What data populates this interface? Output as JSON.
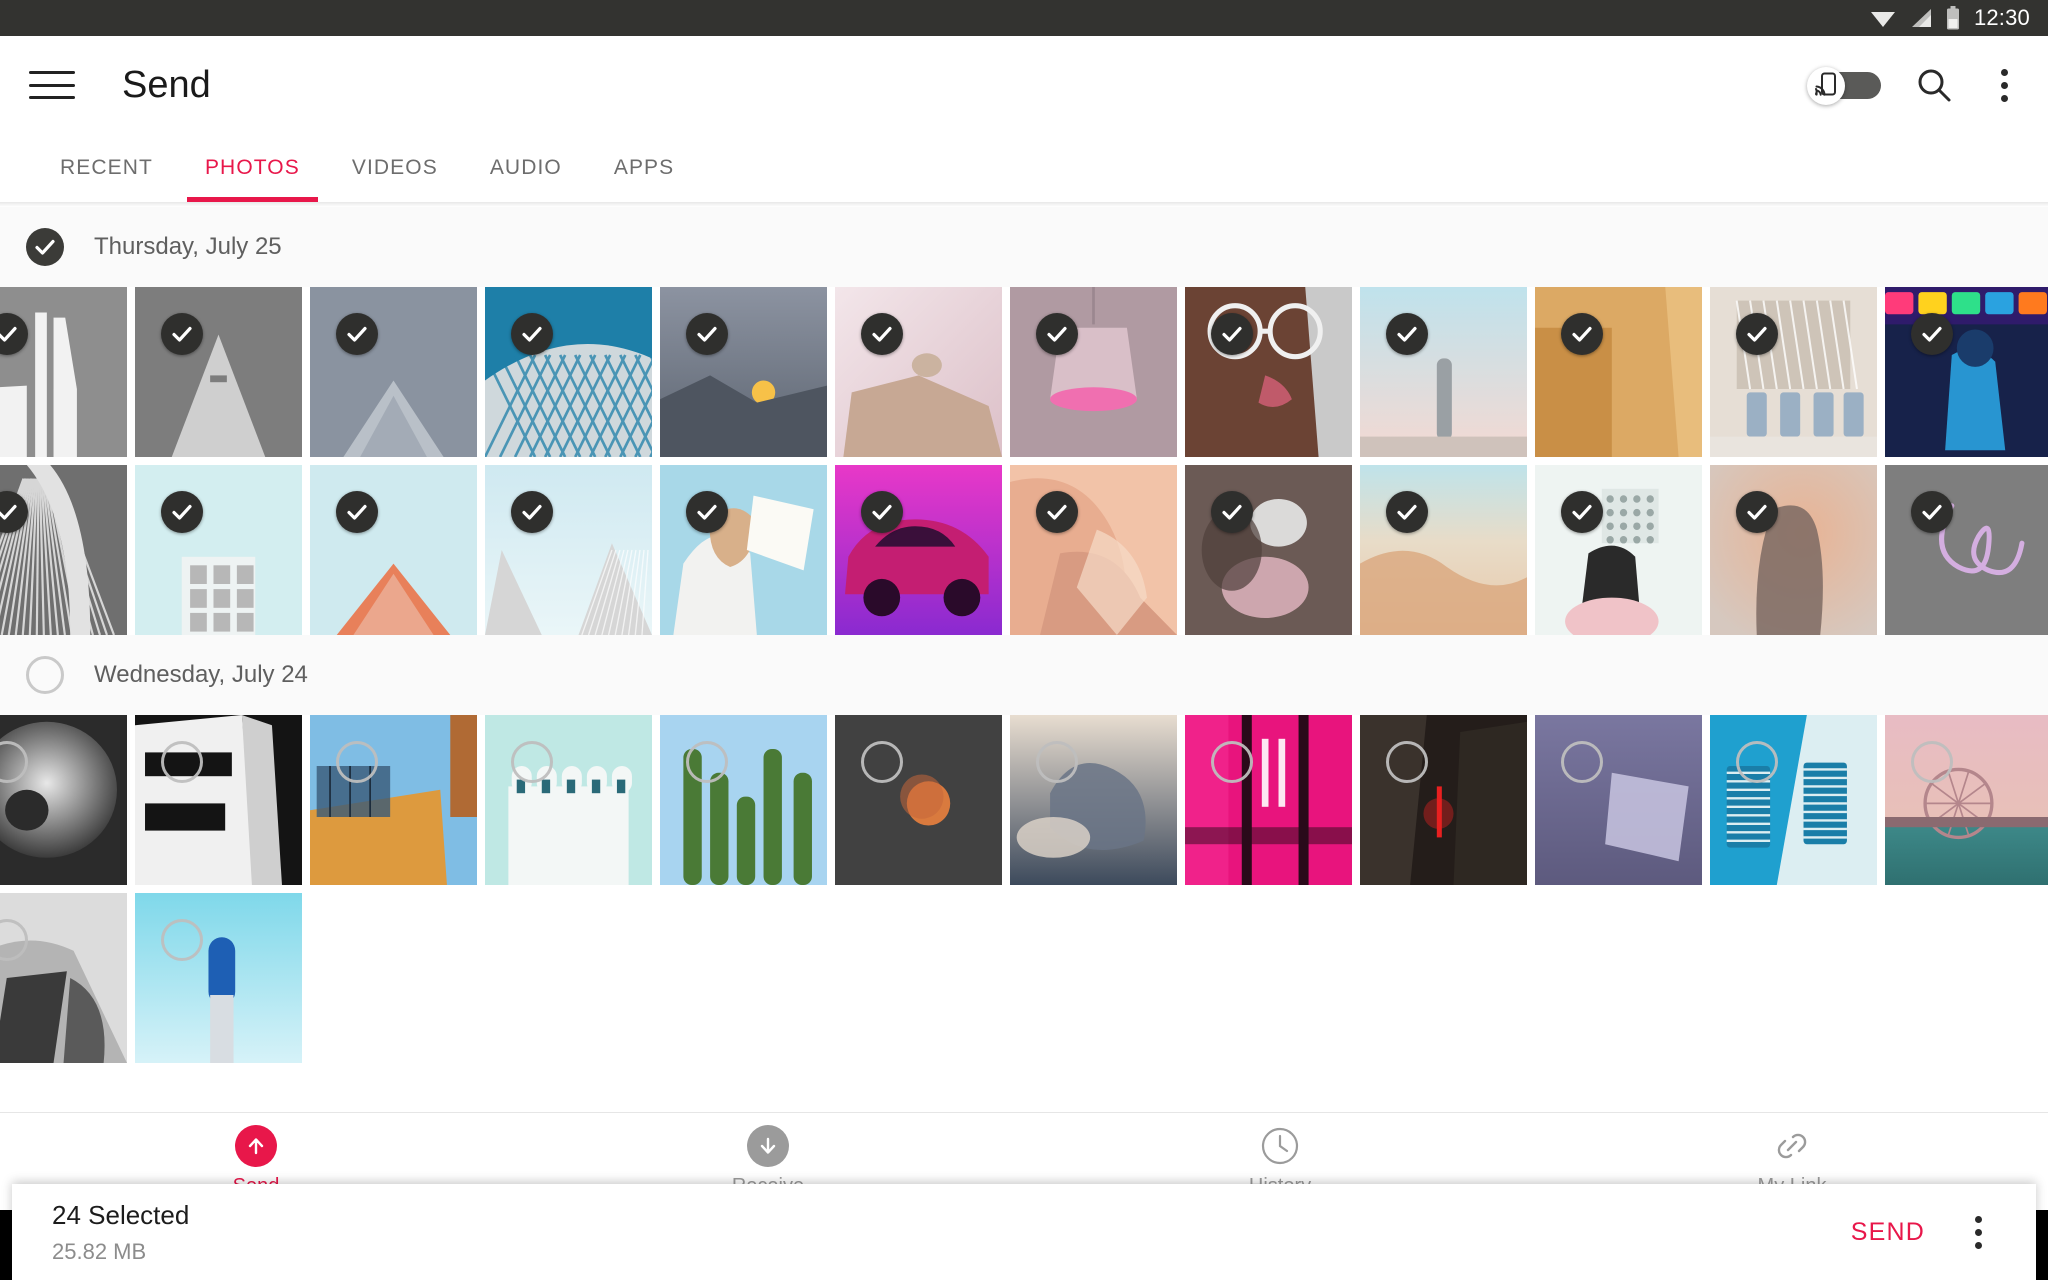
{
  "status_bar": {
    "time": "12:30",
    "icons": [
      "wifi-icon",
      "signal-icon",
      "battery-icon"
    ]
  },
  "toolbar": {
    "menu_icon": "hamburger-menu-icon",
    "title": "Send",
    "cast_toggle": {
      "icon": "cast-phone-icon",
      "state": "off"
    },
    "search_icon": "search-icon",
    "overflow_icon": "overflow-menu-icon"
  },
  "tabs": {
    "active": "PHOTOS",
    "items": [
      {
        "label": "RECENT"
      },
      {
        "label": "PHOTOS"
      },
      {
        "label": "VIDEOS"
      },
      {
        "label": "AUDIO"
      },
      {
        "label": "APPS"
      }
    ]
  },
  "sections": [
    {
      "date_label": "Thursday, July 25",
      "checked": true,
      "photos": [
        {
          "alt": "white-monument-architecture",
          "selected": true,
          "c1": "#8e8e8e",
          "c2": "#f2f2f2",
          "kind": "monument"
        },
        {
          "alt": "concrete-tower-upward",
          "selected": true,
          "c1": "#7d7d7d",
          "c2": "#cfcfcf",
          "kind": "tunnel"
        },
        {
          "alt": "gray-roof-peak",
          "selected": true,
          "c1": "#8a93a0",
          "c2": "#b9c0c8",
          "kind": "peak"
        },
        {
          "alt": "blue-lattice-facade",
          "selected": true,
          "c1": "#1e7fa8",
          "c2": "#cfd8dc",
          "kind": "lattice"
        },
        {
          "alt": "mountain-sunset-dusk",
          "selected": true,
          "c1": "#8c93a1",
          "c2": "#5c6470",
          "kind": "sunset"
        },
        {
          "alt": "leopard-on-rock",
          "selected": true,
          "c1": "#f3e6ea",
          "c2": "#c7a894",
          "kind": "rock"
        },
        {
          "alt": "pink-pendant-lamp",
          "selected": true,
          "c1": "#b09aa2",
          "c2": "#f06fb0",
          "kind": "lamp"
        },
        {
          "alt": "woman-with-glasses-portrait",
          "selected": true,
          "c1": "#6b4334",
          "c2": "#d6b3a0",
          "kind": "portrait"
        },
        {
          "alt": "person-standing-in-mist",
          "selected": true,
          "c1": "#bfe2ec",
          "c2": "#f4d9d2",
          "kind": "mist"
        },
        {
          "alt": "orange-wall-corner",
          "selected": true,
          "c1": "#dca964",
          "c2": "#c98f46",
          "kind": "wall"
        },
        {
          "alt": "hello-hustler-cafe-interior",
          "selected": true,
          "c1": "#e6ded5",
          "c2": "#b9aea1",
          "kind": "cafe"
        },
        {
          "alt": "neon-concert-performer",
          "selected": true,
          "c1": "#17224a",
          "c2": "#2aa2e0",
          "kind": "neon"
        },
        {
          "alt": "bridge-cables-grayscale",
          "selected": true,
          "c1": "#6f6f6f",
          "c2": "#e2e2e2",
          "kind": "cables"
        },
        {
          "alt": "window-grid-pale-blue",
          "selected": true,
          "c1": "#d3eef0",
          "c2": "#b7b7b7",
          "kind": "windows"
        },
        {
          "alt": "orange-roof-house",
          "selected": true,
          "c1": "#cfeaef",
          "c2": "#e8805a",
          "kind": "house"
        },
        {
          "alt": "two-white-gables",
          "selected": true,
          "c1": "#cfe9f1",
          "c2": "#d6d6d6",
          "kind": "gables"
        },
        {
          "alt": "woman-reading-book",
          "selected": true,
          "c1": "#a8d8e8",
          "c2": "#d8b08a",
          "kind": "reading"
        },
        {
          "alt": "magenta-classic-car",
          "selected": true,
          "c1": "#e838c8",
          "c2": "#8a2ad0",
          "kind": "car"
        },
        {
          "alt": "peach-canyon-rock",
          "selected": true,
          "c1": "#f2c3a8",
          "c2": "#d89b82",
          "kind": "canyon"
        },
        {
          "alt": "smoke-portrait-dark",
          "selected": true,
          "c1": "#6b5a55",
          "c2": "#e6b9c4",
          "kind": "smoke"
        },
        {
          "alt": "desert-dune-minimal",
          "selected": true,
          "c1": "#bfe3ea",
          "c2": "#e8c7a8",
          "kind": "dune"
        },
        {
          "alt": "woman-holding-paper",
          "selected": true,
          "c1": "#eef4f2",
          "c2": "#f0c3c8",
          "kind": "paper"
        },
        {
          "alt": "man-bowed-head-orange-glow",
          "selected": true,
          "c1": "#e8b394",
          "c2": "#7d6a63",
          "kind": "glow"
        },
        {
          "alt": "love-light-writing",
          "selected": true,
          "c1": "#7e7e7e",
          "c2": "#d4aee0",
          "kind": "love"
        }
      ]
    },
    {
      "date_label": "Wednesday, July 24",
      "checked": false,
      "photos": [
        {
          "alt": "spiral-sculpture-bw",
          "selected": false,
          "c1": "#2b2b2b",
          "c2": "#e8e8e8",
          "kind": "spiral"
        },
        {
          "alt": "modern-building-bw",
          "selected": false,
          "c1": "#141414",
          "c2": "#f0f0f0",
          "kind": "bwbuild"
        },
        {
          "alt": "orange-brick-building-sky",
          "selected": false,
          "c1": "#7fbde4",
          "c2": "#dd9a3e",
          "kind": "brick"
        },
        {
          "alt": "white-columns-mint",
          "selected": false,
          "c1": "#bfe8e4",
          "c2": "#f3f7f6",
          "kind": "columns"
        },
        {
          "alt": "cactus-against-sky",
          "selected": false,
          "c1": "#a8d4f0",
          "c2": "#4a7a36",
          "kind": "cactus"
        },
        {
          "alt": "blood-moon-dark-sky",
          "selected": false,
          "c1": "#414141",
          "c2": "#d97a3e",
          "kind": "moon"
        },
        {
          "alt": "dramatic-clouds-sunset",
          "selected": false,
          "c1": "#e8ddd0",
          "c2": "#3d4a5c",
          "kind": "clouds"
        },
        {
          "alt": "pink-neon-corridor",
          "selected": false,
          "c1": "#e8147d",
          "c2": "#2a0a1a",
          "kind": "corridor"
        },
        {
          "alt": "red-light-cave-rock",
          "selected": false,
          "c1": "#241d1a",
          "c2": "#e82020",
          "kind": "cave"
        },
        {
          "alt": "purple-floating-panel",
          "selected": false,
          "c1": "#5d5a7e",
          "c2": "#c8c4e0",
          "kind": "panel"
        },
        {
          "alt": "blue-shutters-wall",
          "selected": false,
          "c1": "#1fa0cf",
          "c2": "#dceef2",
          "kind": "shutters"
        },
        {
          "alt": "ferris-wheel-pier-pink",
          "selected": false,
          "c1": "#e8bcc4",
          "c2": "#3e8a8a",
          "kind": "ferris"
        },
        {
          "alt": "abstract-gray-curves",
          "selected": false,
          "c1": "#dcdcdc",
          "c2": "#3a3a3a",
          "kind": "curves"
        },
        {
          "alt": "blue-capsule-tower",
          "selected": false,
          "c1": "#7fd8ea",
          "c2": "#1e5fb4",
          "kind": "capsule"
        }
      ]
    }
  ],
  "selection_panel": {
    "count_label": "24 Selected",
    "size_label": "25.82 MB",
    "send_label": "SEND",
    "overflow_icon": "overflow-menu-icon"
  },
  "bottom_nav": {
    "active": "Send",
    "items": [
      {
        "label": "Send",
        "icon": "upload-arrow-icon",
        "active": true
      },
      {
        "label": "Receive",
        "icon": "download-arrow-icon",
        "active": false
      },
      {
        "label": "History",
        "icon": "clock-icon",
        "active": false
      },
      {
        "label": "My Link",
        "icon": "link-icon",
        "active": false
      }
    ]
  },
  "android_nav": {
    "items": [
      {
        "icon": "back-triangle-icon"
      },
      {
        "icon": "home-circle-icon"
      },
      {
        "icon": "recents-square-icon"
      }
    ]
  },
  "colors": {
    "accent": "#E8174A",
    "status_bar_bg": "#333330",
    "checkbox_checked": "#2f2f2d"
  }
}
